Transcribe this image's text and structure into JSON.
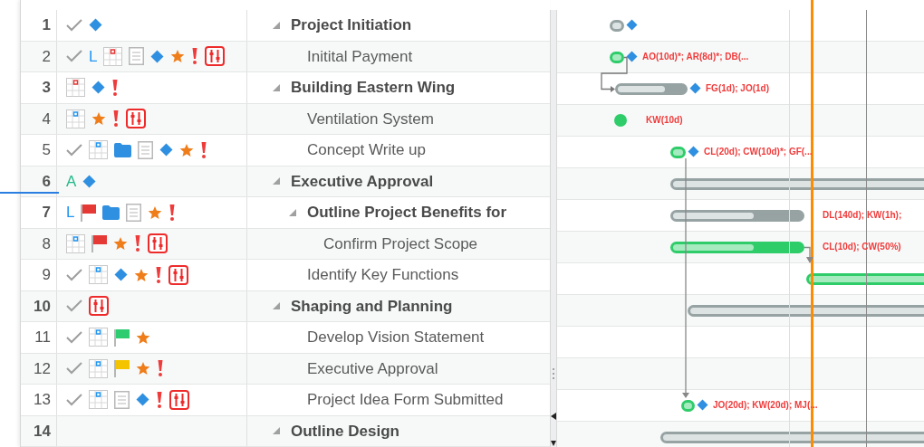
{
  "tasks": [
    {
      "number": "1",
      "name": "Project Initiation",
      "expanded": true,
      "indicators": [
        {
          "kind": "check"
        },
        {
          "kind": "diamond"
        }
      ],
      "gantt": {
        "kind": "summary",
        "diamond": true
      },
      "children": [
        {
          "number": "2",
          "name": "Initital Payment",
          "indicators": [
            {
              "kind": "check"
            },
            {
              "kind": "letter",
              "text": "L",
              "color": "#2196f3"
            },
            {
              "kind": "grid",
              "color": "#e53935"
            },
            {
              "kind": "notes"
            },
            {
              "kind": "diamond"
            },
            {
              "kind": "star"
            },
            {
              "kind": "exclaim"
            },
            {
              "kind": "constraint"
            }
          ],
          "gantt": {
            "kind": "task",
            "diamond": true,
            "label": "AO(10d)*; AR(8d)*; DB(..."
          }
        }
      ]
    },
    {
      "number": "3",
      "name": "Building Eastern Wing",
      "expanded": true,
      "indicators": [
        {
          "kind": "grid",
          "color": "#e53935"
        },
        {
          "kind": "diamond"
        },
        {
          "kind": "exclaim"
        }
      ],
      "gantt": {
        "kind": "summary",
        "level": 0.7,
        "diamond": true,
        "label": "FG(1d); JO(1d)"
      },
      "children": [
        {
          "number": "4",
          "name": "Ventilation System",
          "indicators": [
            {
              "kind": "grid",
              "color": "#2196f3"
            },
            {
              "kind": "star"
            },
            {
              "kind": "exclaim"
            },
            {
              "kind": "constraint"
            }
          ],
          "gantt": {
            "kind": "milestone",
            "label": "KW(10d)"
          }
        },
        {
          "number": "5",
          "name": "Concept Write up",
          "indicators": [
            {
              "kind": "check"
            },
            {
              "kind": "grid",
              "color": "#2196f3"
            },
            {
              "kind": "folder"
            },
            {
              "kind": "notes"
            },
            {
              "kind": "diamond"
            },
            {
              "kind": "star"
            },
            {
              "kind": "exclaim"
            }
          ],
          "gantt": {
            "kind": "task",
            "diamond": true,
            "label": "CL(20d); CW(10d)*; GF(..."
          }
        }
      ]
    },
    {
      "number": "6",
      "name": "Executive Approval",
      "expanded": true,
      "indicators": [
        {
          "kind": "letter",
          "text": "A",
          "color": "#26b98a"
        },
        {
          "kind": "diamond"
        }
      ],
      "gantt": {
        "kind": "summary",
        "level": 1
      },
      "children": [
        {
          "number": "7",
          "name": "Outline Project Benefits for",
          "expanded": true,
          "indicators": [
            {
              "kind": "letter",
              "text": "L",
              "color": "#2196f3"
            },
            {
              "kind": "flag",
              "color": "#e53935"
            },
            {
              "kind": "folder"
            },
            {
              "kind": "notes"
            },
            {
              "kind": "star"
            },
            {
              "kind": "exclaim"
            }
          ],
          "gantt": {
            "kind": "summary",
            "level": 0.63,
            "label": "DL(140d); KW(1h);"
          },
          "children": [
            {
              "number": "8",
              "name": "Confirm Project Scope",
              "indicators": [
                {
                  "kind": "grid",
                  "color": "#2196f3"
                },
                {
                  "kind": "flag",
                  "color": "#e53935"
                },
                {
                  "kind": "star"
                },
                {
                  "kind": "exclaim"
                },
                {
                  "kind": "constraint"
                }
              ],
              "gantt": {
                "kind": "task",
                "level": 0.63,
                "label": "CL(10d); CW(50%)"
              }
            }
          ]
        },
        {
          "number": "9",
          "name": "Identify Key Functions",
          "indicators": [
            {
              "kind": "check"
            },
            {
              "kind": "grid",
              "color": "#2196f3"
            },
            {
              "kind": "diamond"
            },
            {
              "kind": "star"
            },
            {
              "kind": "exclaim"
            },
            {
              "kind": "constraint"
            }
          ],
          "gantt": {
            "kind": "task",
            "level": 1
          }
        }
      ]
    },
    {
      "number": "10",
      "name": "Shaping and Planning",
      "expanded": true,
      "indicators": [
        {
          "kind": "check"
        },
        {
          "kind": "constraint"
        }
      ],
      "gantt": {
        "kind": "summary",
        "level": 1
      },
      "children": [
        {
          "number": "11",
          "name": "Develop Vision Statement",
          "indicators": [
            {
              "kind": "check"
            },
            {
              "kind": "grid",
              "color": "#2196f3"
            },
            {
              "kind": "flag",
              "color": "#2ecc71"
            },
            {
              "kind": "star"
            }
          ]
        },
        {
          "number": "12",
          "name": "Executive Approval",
          "indicators": [
            {
              "kind": "check"
            },
            {
              "kind": "grid",
              "color": "#2196f3"
            },
            {
              "kind": "flag",
              "color": "#f5c400"
            },
            {
              "kind": "star"
            },
            {
              "kind": "exclaim"
            }
          ]
        },
        {
          "number": "13",
          "name": "Project Idea Form Submitted",
          "indicators": [
            {
              "kind": "check"
            },
            {
              "kind": "grid",
              "color": "#2196f3"
            },
            {
              "kind": "notes"
            },
            {
              "kind": "diamond"
            },
            {
              "kind": "exclaim"
            },
            {
              "kind": "constraint"
            }
          ],
          "gantt": {
            "kind": "task",
            "diamond": true,
            "label": "JO(20d); KW(20d); MJ(..."
          }
        }
      ]
    },
    {
      "number": "14",
      "name": "Outline Design",
      "expanded": true,
      "gantt": {
        "kind": "summary",
        "level": 1
      }
    }
  ]
}
